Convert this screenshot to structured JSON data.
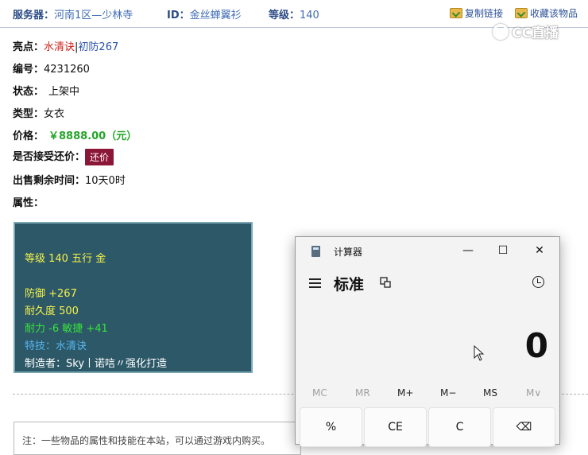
{
  "top_bar": {
    "server_label": "服务器：",
    "server_value": "河南1区—少林寺",
    "id_label": "ID：",
    "id_value": "金丝蝉翼衫",
    "level_label": "等级：",
    "level_value": "140",
    "copy_link": "复制链接",
    "favorite": "收藏该物品"
  },
  "watermark": "CC直播",
  "details": {
    "highlight_label": "亮点：",
    "highlight_red": "水清诀",
    "highlight_sep": "|",
    "highlight_blue": "初防267",
    "number_label": "编号：",
    "number_value": "4231260",
    "status_label": "状态：",
    "status_value": "上架中",
    "type_label": "类型：",
    "type_value": "女衣",
    "price_label": "价格：",
    "price_value": "￥8888.00（元）",
    "haggle_label": "是否接受还价：",
    "haggle_button": "还价",
    "remaining_label": "出售剩余时间：",
    "remaining_value": "10天0时",
    "attr_label": "属性："
  },
  "attributes": {
    "level_line": "等级 140 五行 金",
    "defense": "防御 +267",
    "durability": "耐久度 500",
    "stats": "耐力 -6 敏捷 +41",
    "skill": "特技：水清诀",
    "maker": "制造者：Sky丨诺唁〃强化打造"
  },
  "note_text": "注：一些物品的属性和技能在本站，可以通过游戏内购买。",
  "calculator": {
    "app_title": "计算器",
    "mode_title": "标准",
    "display": "0",
    "memory": [
      "MC",
      "MR",
      "M+",
      "M−",
      "MS",
      "M∨"
    ],
    "keys": [
      "%",
      "CE",
      "C",
      "⌫"
    ],
    "minimize": "—",
    "maximize": "☐",
    "close": "✕"
  }
}
